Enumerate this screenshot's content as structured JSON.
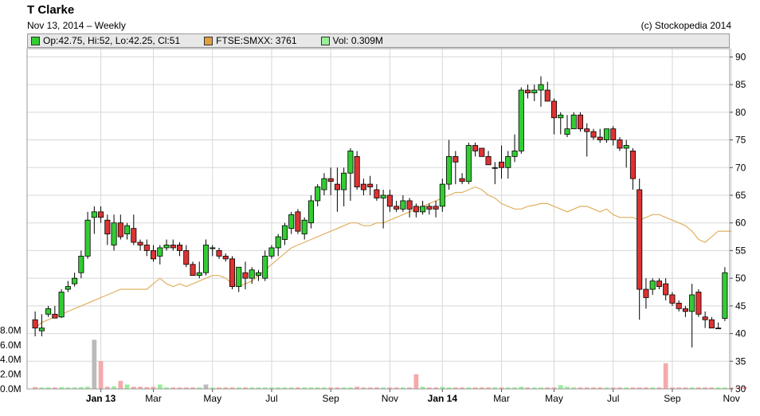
{
  "header": {
    "title": "T Clarke",
    "subtitle": "Nov 13, 2014  –  Weekly",
    "copyright": "(c) Stockopedia 2014"
  },
  "legend": [
    {
      "label": "Op:42.75, Hi:52, Lo:42.25, Cl:51",
      "color": "#33cc33"
    },
    {
      "label": "FTSE:SMXX: 3761",
      "color": "#e0a040"
    },
    {
      "label": "Vol: 0.309M",
      "color": "#99ee99"
    }
  ],
  "chart_data": {
    "type": "candlestick",
    "y_ticks": [
      30,
      35,
      40,
      45,
      50,
      55,
      60,
      65,
      70,
      75,
      80,
      85,
      90
    ],
    "ylim": [
      30,
      91.5
    ],
    "volume_ticks": [
      "0.0M",
      "2.0M",
      "4.0M",
      "6.0M",
      "8.0M"
    ],
    "volume_tick_values": [
      0,
      2,
      4,
      6,
      8
    ],
    "x_labels": [
      {
        "label": "Jan 13",
        "week": 10,
        "bold": true
      },
      {
        "label": "Mar",
        "week": 18,
        "bold": false
      },
      {
        "label": "May",
        "week": 27,
        "bold": false
      },
      {
        "label": "Jul",
        "week": 36,
        "bold": false
      },
      {
        "label": "Sep",
        "week": 45,
        "bold": false
      },
      {
        "label": "Nov",
        "week": 54,
        "bold": false
      },
      {
        "label": "Jan 14",
        "week": 62,
        "bold": true
      },
      {
        "label": "Mar",
        "week": 71,
        "bold": false
      },
      {
        "label": "May",
        "week": 79,
        "bold": false
      },
      {
        "label": "Jul",
        "week": 88,
        "bold": false
      },
      {
        "label": "Sep",
        "week": 97,
        "bold": false
      },
      {
        "label": "Nov",
        "week": 106,
        "bold": false
      }
    ],
    "candles": [
      [
        42.5,
        44,
        39.5,
        41
      ],
      [
        40.5,
        43.5,
        39.5,
        41
      ],
      [
        43.5,
        45,
        43,
        44.5
      ],
      [
        43.5,
        45,
        43,
        42.8
      ],
      [
        43,
        48,
        42.8,
        47.5
      ],
      [
        48,
        49.5,
        47.5,
        48.5
      ],
      [
        49,
        51,
        48.5,
        50
      ],
      [
        51,
        55,
        50,
        54
      ],
      [
        54,
        62,
        53.5,
        60.5
      ],
      [
        61,
        63,
        58,
        62
      ],
      [
        62,
        63,
        60,
        61
      ],
      [
        60.5,
        61.5,
        56,
        58
      ],
      [
        56,
        61.5,
        55,
        60
      ],
      [
        60,
        61.5,
        57,
        57.5
      ],
      [
        58,
        60,
        57,
        59.5
      ],
      [
        59,
        61.5,
        56,
        56.5
      ],
      [
        56.5,
        57,
        55,
        56
      ],
      [
        56,
        57,
        54,
        55
      ],
      [
        55,
        56,
        53,
        53.5
      ],
      [
        54,
        56,
        52.5,
        55.5
      ],
      [
        55.5,
        57,
        55,
        56
      ],
      [
        56,
        57,
        55,
        55.5
      ],
      [
        56,
        56.5,
        54,
        55
      ],
      [
        55,
        56,
        52,
        52.5
      ],
      [
        52.5,
        53,
        50.5,
        50.5
      ],
      [
        50.5,
        53,
        50,
        51
      ],
      [
        51,
        57,
        50.5,
        56
      ],
      [
        55.5,
        56,
        54,
        55.5
      ],
      [
        55,
        55.5,
        53.5,
        54
      ],
      [
        54,
        54.5,
        53,
        53.5
      ],
      [
        53.5,
        54,
        48,
        48.5
      ],
      [
        48.5,
        52,
        47.5,
        52
      ],
      [
        51,
        53,
        48,
        50
      ],
      [
        50,
        52,
        49,
        51.5
      ],
      [
        50.5,
        51.5,
        49.5,
        51
      ],
      [
        50,
        55,
        49.5,
        54
      ],
      [
        54,
        56,
        53.5,
        55.5
      ],
      [
        55.5,
        58,
        54,
        57.5
      ],
      [
        57,
        60,
        56,
        59.5
      ],
      [
        59,
        62,
        58,
        61.5
      ],
      [
        62,
        62.5,
        58,
        58.5
      ],
      [
        58,
        61,
        57,
        60.5
      ],
      [
        60,
        65,
        59,
        64
      ],
      [
        64,
        67,
        63,
        66.5
      ],
      [
        66,
        69,
        65,
        68
      ],
      [
        68,
        70,
        65,
        67.5
      ],
      [
        67,
        70,
        62,
        66
      ],
      [
        66,
        70,
        63,
        69
      ],
      [
        69,
        73.5,
        64,
        73
      ],
      [
        72,
        73,
        66,
        66.5
      ],
      [
        67,
        68,
        65,
        66
      ],
      [
        67,
        68.5,
        65,
        66.5
      ],
      [
        66,
        67,
        64,
        64.5
      ],
      [
        64.5,
        66,
        59,
        65
      ],
      [
        65,
        66,
        62,
        63
      ],
      [
        63,
        64,
        62,
        62.5
      ],
      [
        62.5,
        65,
        62,
        64
      ],
      [
        64,
        64.5,
        61,
        62.5
      ],
      [
        63,
        63.5,
        61,
        62
      ],
      [
        62,
        64,
        61.5,
        63
      ],
      [
        63,
        63.5,
        61.5,
        62.5
      ],
      [
        63,
        64,
        61,
        62.5
      ],
      [
        63,
        68,
        62,
        67
      ],
      [
        67,
        75,
        66,
        72
      ],
      [
        72,
        73,
        67,
        71
      ],
      [
        68,
        69,
        67,
        67.5
      ],
      [
        67.5,
        74.5,
        67,
        74
      ],
      [
        74,
        74.5,
        72,
        73
      ],
      [
        73.5,
        73.5,
        72,
        72
      ],
      [
        72,
        73,
        70.5,
        70.5
      ],
      [
        70,
        71,
        67,
        70
      ],
      [
        71,
        74,
        68,
        70
      ],
      [
        70,
        73,
        68,
        72
      ],
      [
        72,
        76,
        71,
        73
      ],
      [
        73,
        84.5,
        72.5,
        84
      ],
      [
        84,
        85,
        82.5,
        83.5
      ],
      [
        83.5,
        85,
        82,
        84
      ],
      [
        84,
        86.5,
        81,
        85
      ],
      [
        84,
        85.5,
        82,
        82
      ],
      [
        82,
        82.5,
        76,
        79
      ],
      [
        79,
        80,
        76,
        79.5
      ],
      [
        76,
        79.5,
        75.5,
        77
      ],
      [
        77,
        80,
        77,
        79.5
      ],
      [
        79.5,
        80,
        76.5,
        77
      ],
      [
        77,
        78,
        72,
        76.5
      ],
      [
        76.5,
        77,
        75,
        75.5
      ],
      [
        75.5,
        77,
        74.5,
        75
      ],
      [
        75,
        76,
        74.5,
        77
      ],
      [
        77,
        77.5,
        74,
        75
      ],
      [
        75,
        75.5,
        73,
        73.5
      ],
      [
        73.5,
        75,
        70,
        74
      ],
      [
        73,
        73.5,
        66,
        68
      ],
      [
        66,
        68,
        42.5,
        48
      ],
      [
        48,
        50,
        44.5,
        46.5
      ],
      [
        48,
        50,
        47,
        49.5
      ],
      [
        49.5,
        50,
        48,
        48.5
      ],
      [
        49,
        50,
        46,
        47
      ],
      [
        47,
        47.5,
        45,
        45.5
      ],
      [
        45.5,
        46,
        44,
        44.5
      ],
      [
        44.5,
        45,
        43,
        44
      ],
      [
        44,
        49,
        37.5,
        47
      ],
      [
        47.5,
        48,
        43,
        43.5
      ],
      [
        43,
        44,
        41,
        42.5
      ],
      [
        42.5,
        43,
        41,
        41
      ],
      [
        41,
        42,
        41,
        41
      ],
      [
        42.75,
        52,
        42.25,
        51
      ]
    ],
    "ftse": [
      41,
      42,
      42.5,
      43,
      43.5,
      44,
      44.5,
      45,
      45.5,
      46,
      46.5,
      47,
      47.5,
      48,
      48,
      48,
      48,
      48,
      49,
      50,
      49,
      48.5,
      49,
      48.5,
      49,
      49.5,
      50,
      50.5,
      50.5,
      50,
      49,
      48.5,
      49,
      49.5,
      50.5,
      51.5,
      52.5,
      53.5,
      54.5,
      55.5,
      56,
      56.5,
      57,
      57.5,
      58,
      58.5,
      59,
      59.5,
      60,
      60,
      59.5,
      59.5,
      60,
      60,
      60.5,
      61,
      61.5,
      62,
      62.5,
      63,
      63.5,
      64,
      64.5,
      65,
      65.5,
      65.5,
      66,
      66.5,
      66,
      65,
      64.5,
      63.5,
      63,
      62.5,
      62.5,
      63,
      63.2,
      63.5,
      63.5,
      63,
      62.5,
      62,
      62.5,
      63,
      63,
      62.5,
      62,
      62.5,
      61.5,
      61,
      61,
      61,
      60.5,
      61,
      61.5,
      61.5,
      61,
      60.5,
      60,
      59.5,
      58.5,
      57,
      56.5,
      57.5,
      58.5,
      58.5,
      58.5
    ],
    "volume": [
      0.25,
      0.2,
      0.2,
      0.2,
      0.25,
      0.2,
      0.2,
      0.25,
      0.3,
      6.7,
      3.8,
      0.3,
      0.35,
      1.1,
      0.6,
      0.3,
      0.3,
      0.25,
      0.3,
      0.6,
      0.2,
      0.2,
      0.2,
      0.2,
      0.2,
      0.2,
      0.6,
      0.2,
      0.2,
      0.2,
      0.2,
      0.2,
      0.2,
      0.2,
      0.2,
      0.2,
      0.2,
      0.2,
      0.2,
      0.2,
      0.2,
      0.2,
      0.2,
      0.2,
      0.2,
      0.2,
      0.2,
      0.2,
      0.2,
      0.3,
      0.2,
      0.2,
      0.2,
      0.2,
      0.2,
      0.2,
      0.2,
      0.2,
      2.0,
      0.3,
      0.2,
      0.2,
      0.3,
      0.2,
      0.2,
      0.2,
      0.2,
      0.2,
      0.2,
      0.2,
      0.2,
      0.2,
      0.2,
      0.2,
      0.3,
      0.2,
      0.2,
      0.2,
      0.2,
      0.2,
      0.5,
      0.3,
      0.2,
      0.2,
      0.2,
      0.2,
      0.2,
      0.2,
      0.2,
      0.2,
      0.2,
      0.2,
      0.2,
      0.2,
      0.2,
      0.2,
      3.5,
      0.2,
      0.2,
      0.2,
      0.2,
      0.2,
      0.2,
      0.2,
      0.2,
      0.2,
      0.2,
      0.2,
      0.31
    ],
    "volume_gray_weeks": [
      9,
      26
    ],
    "colors": {
      "up": "#33cc33",
      "down": "#dd3333",
      "ftse": "#e0b060",
      "vol_up": "#99ee99",
      "vol_down": "#f4aaaa",
      "vol_gray": "#bbbbbb",
      "grid": "#d8d8d8"
    }
  }
}
